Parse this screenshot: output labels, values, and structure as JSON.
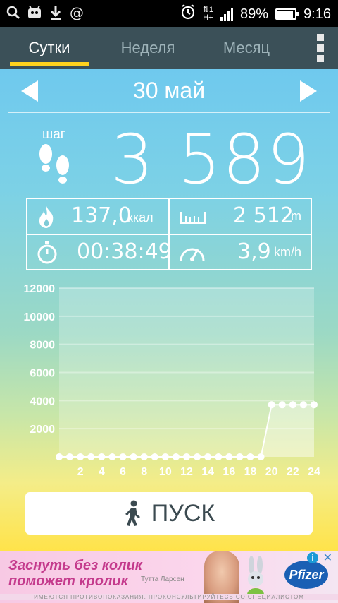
{
  "status_bar": {
    "battery_percent": "89%",
    "time": "9:16",
    "network": "H+",
    "sim": "1"
  },
  "tabs": [
    {
      "label": "Сутки",
      "active": true
    },
    {
      "label": "Неделя",
      "active": false
    },
    {
      "label": "Месяц",
      "active": false
    }
  ],
  "date": "30 май",
  "steps": {
    "label": "шаг",
    "value": "3 589"
  },
  "stats": {
    "calories": {
      "value": "137,0",
      "unit": "ккал"
    },
    "distance": {
      "value": "2 512",
      "unit": "m"
    },
    "duration": {
      "value": "00:38:49"
    },
    "speed": {
      "value": "3,9",
      "unit": "km/h"
    }
  },
  "chart_data": {
    "type": "line",
    "x": [
      0,
      1,
      2,
      3,
      4,
      5,
      6,
      7,
      8,
      9,
      10,
      11,
      12,
      13,
      14,
      15,
      16,
      17,
      18,
      19,
      20,
      21,
      22,
      23,
      24
    ],
    "xtick_labels": [
      "2",
      "4",
      "6",
      "8",
      "10",
      "12",
      "14",
      "16",
      "18",
      "20",
      "22",
      "24"
    ],
    "xticks": [
      2,
      4,
      6,
      8,
      10,
      12,
      14,
      16,
      18,
      20,
      22,
      24
    ],
    "y": [
      0,
      0,
      0,
      0,
      0,
      0,
      0,
      0,
      0,
      0,
      0,
      0,
      0,
      0,
      0,
      0,
      0,
      0,
      0,
      0,
      3700,
      3700,
      3700,
      3700,
      3700
    ],
    "ytick_labels": [
      "2000",
      "4000",
      "6000",
      "8000",
      "10000",
      "12000"
    ],
    "yticks": [
      2000,
      4000,
      6000,
      8000,
      10000,
      12000
    ],
    "ylim": [
      0,
      12000
    ],
    "xlim": [
      0,
      24
    ],
    "grid": true
  },
  "start_button": {
    "label": "ПУСК"
  },
  "ad": {
    "line1": "Заснуть без колик",
    "line2": "поможет кролик",
    "person": "Тутта Ларсен",
    "brand": "Pfizer",
    "info": "i",
    "close": "✕",
    "disclaimer": "ИМЕЮТСЯ ПРОТИВОПОКАЗАНИЯ, ПРОКОНСУЛЬТИРУЙТЕСЬ СО СПЕЦИАЛИСТОМ"
  },
  "colors": {
    "tab_bar": "#3b5058",
    "tab_underline": "#ffd21e",
    "chart_line": "#ffffff",
    "chart_tick": "#ffffff"
  }
}
